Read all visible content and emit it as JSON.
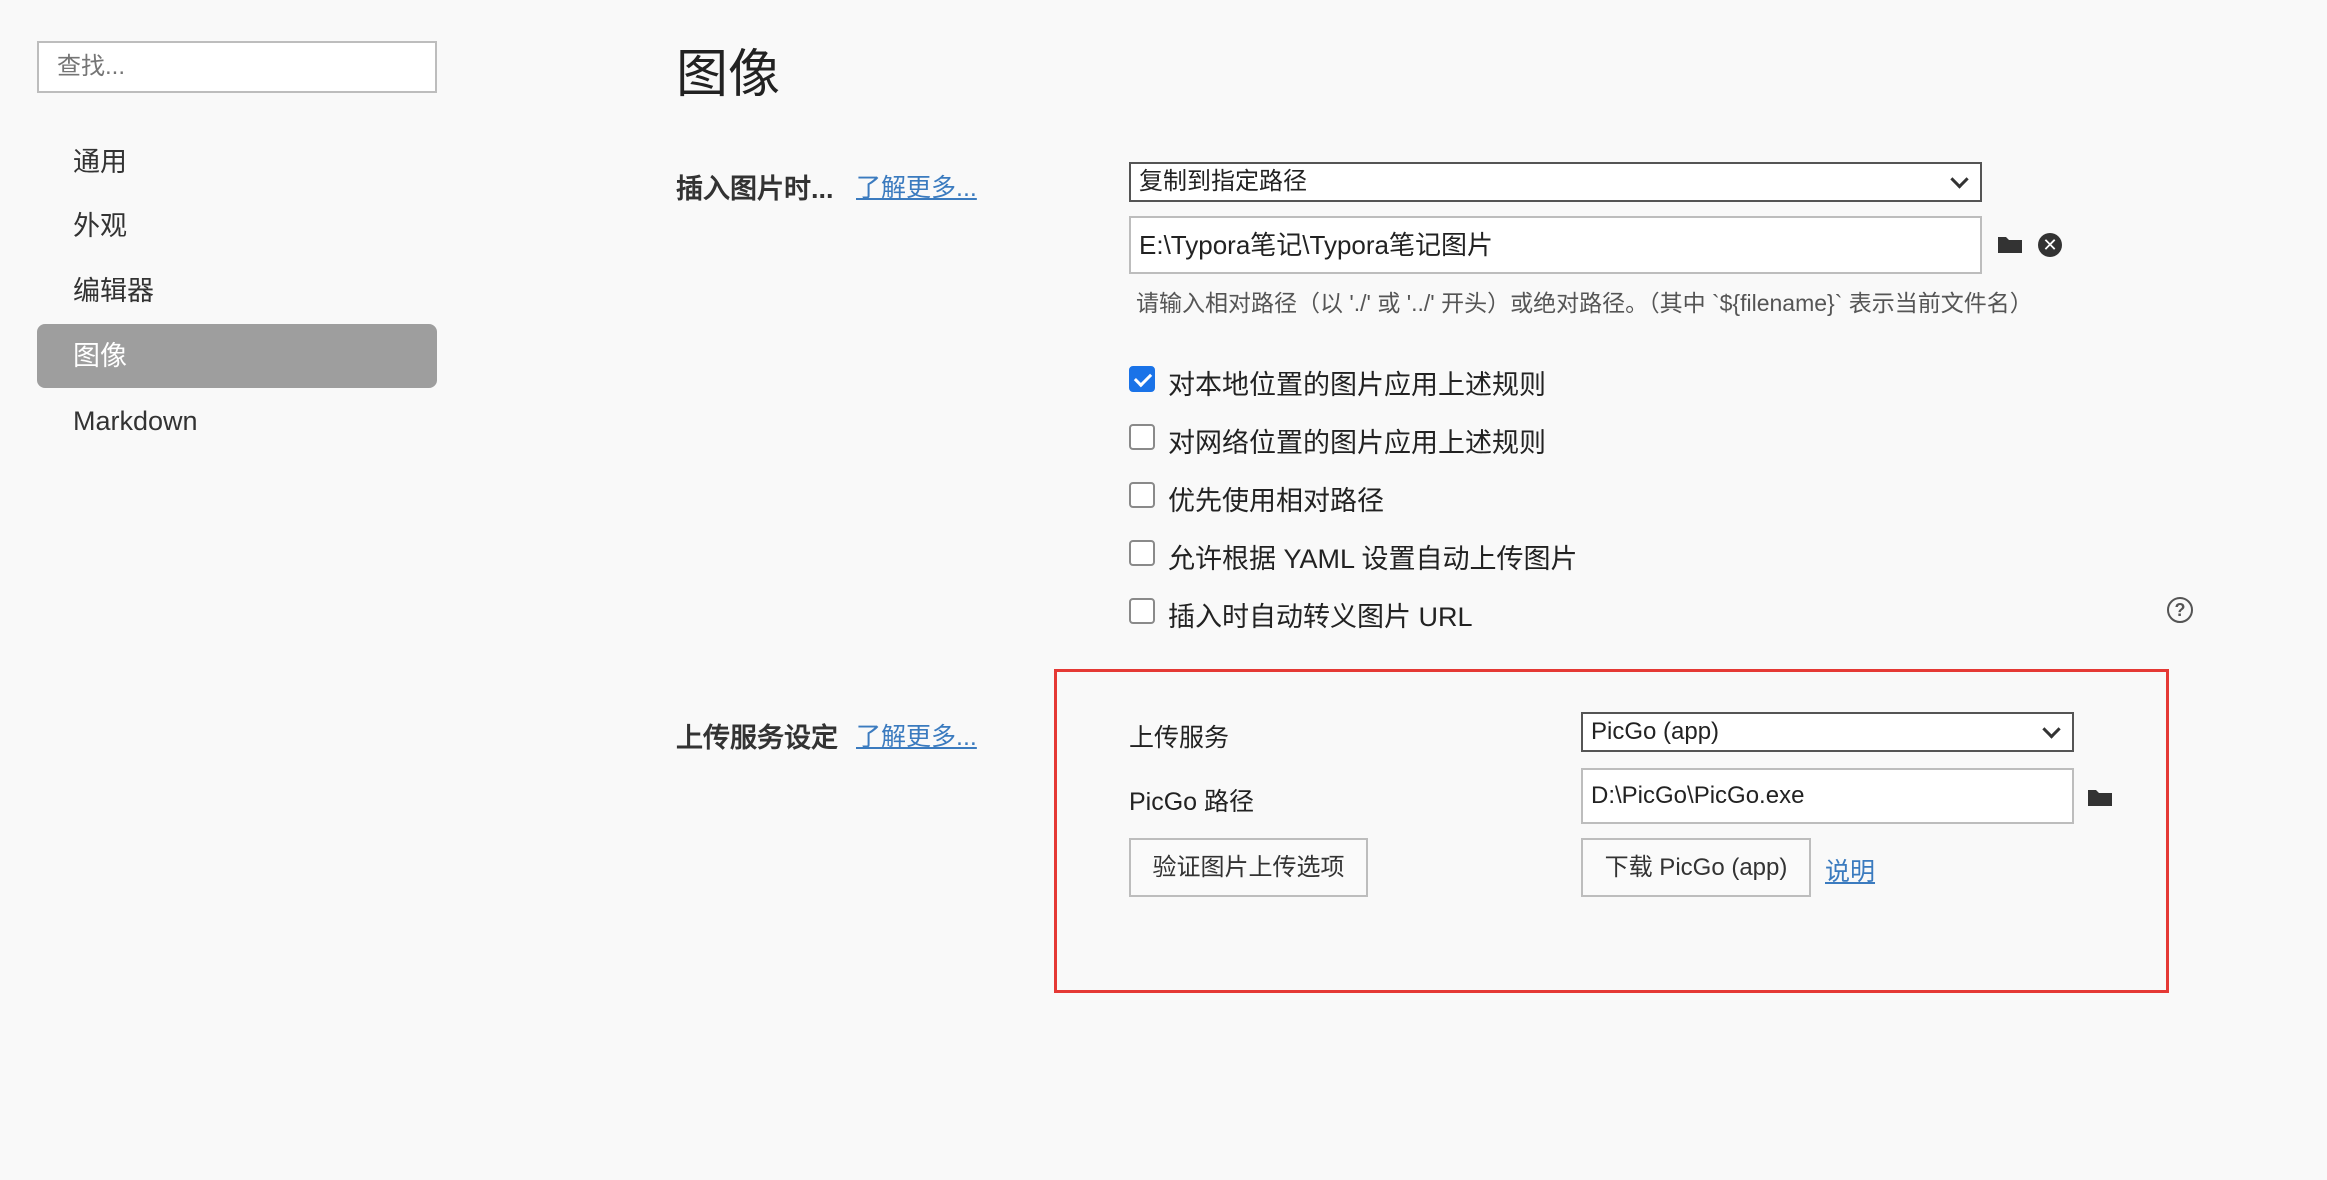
{
  "sidebar": {
    "search_placeholder": "查找...",
    "items": [
      {
        "label": "通用"
      },
      {
        "label": "外观"
      },
      {
        "label": "编辑器"
      },
      {
        "label": "图像"
      },
      {
        "label": "Markdown"
      }
    ],
    "active_index": 3
  },
  "main": {
    "title": "图像",
    "insert_section": {
      "label": "插入图片时...",
      "learn_more": "了解更多...",
      "action_select": "复制到指定路径",
      "path_value": "E:\\Typora笔记\\Typora笔记图片",
      "hint": "请输入相对路径（以 './' 或 '../' 开头）或绝对路径。（其中 `${filename}` 表示当前文件名）",
      "options": [
        {
          "label": "对本地位置的图片应用上述规则",
          "checked": true
        },
        {
          "label": "对网络位置的图片应用上述规则",
          "checked": false
        },
        {
          "label": "优先使用相对路径",
          "checked": false
        },
        {
          "label": "允许根据 YAML 设置自动上传图片",
          "checked": false
        },
        {
          "label": "插入时自动转义图片 URL",
          "checked": false
        }
      ]
    },
    "upload_section": {
      "label": "上传服务设定",
      "learn_more": "了解更多...",
      "service_label": "上传服务",
      "service_value": "PicGo (app)",
      "path_label": "PicGo 路径",
      "path_value": "D:\\PicGo\\PicGo.exe",
      "verify_button": "验证图片上传选项",
      "download_button": "下载 PicGo (app)",
      "doc_link": "说明"
    }
  },
  "icons": {
    "folder": "folder-icon",
    "clear": "clear-icon",
    "help": "help-icon"
  },
  "colors": {
    "accent": "#1a73e8",
    "link": "#3b7bbf",
    "highlight_border": "#e53935",
    "active_nav": "#9e9e9e"
  }
}
